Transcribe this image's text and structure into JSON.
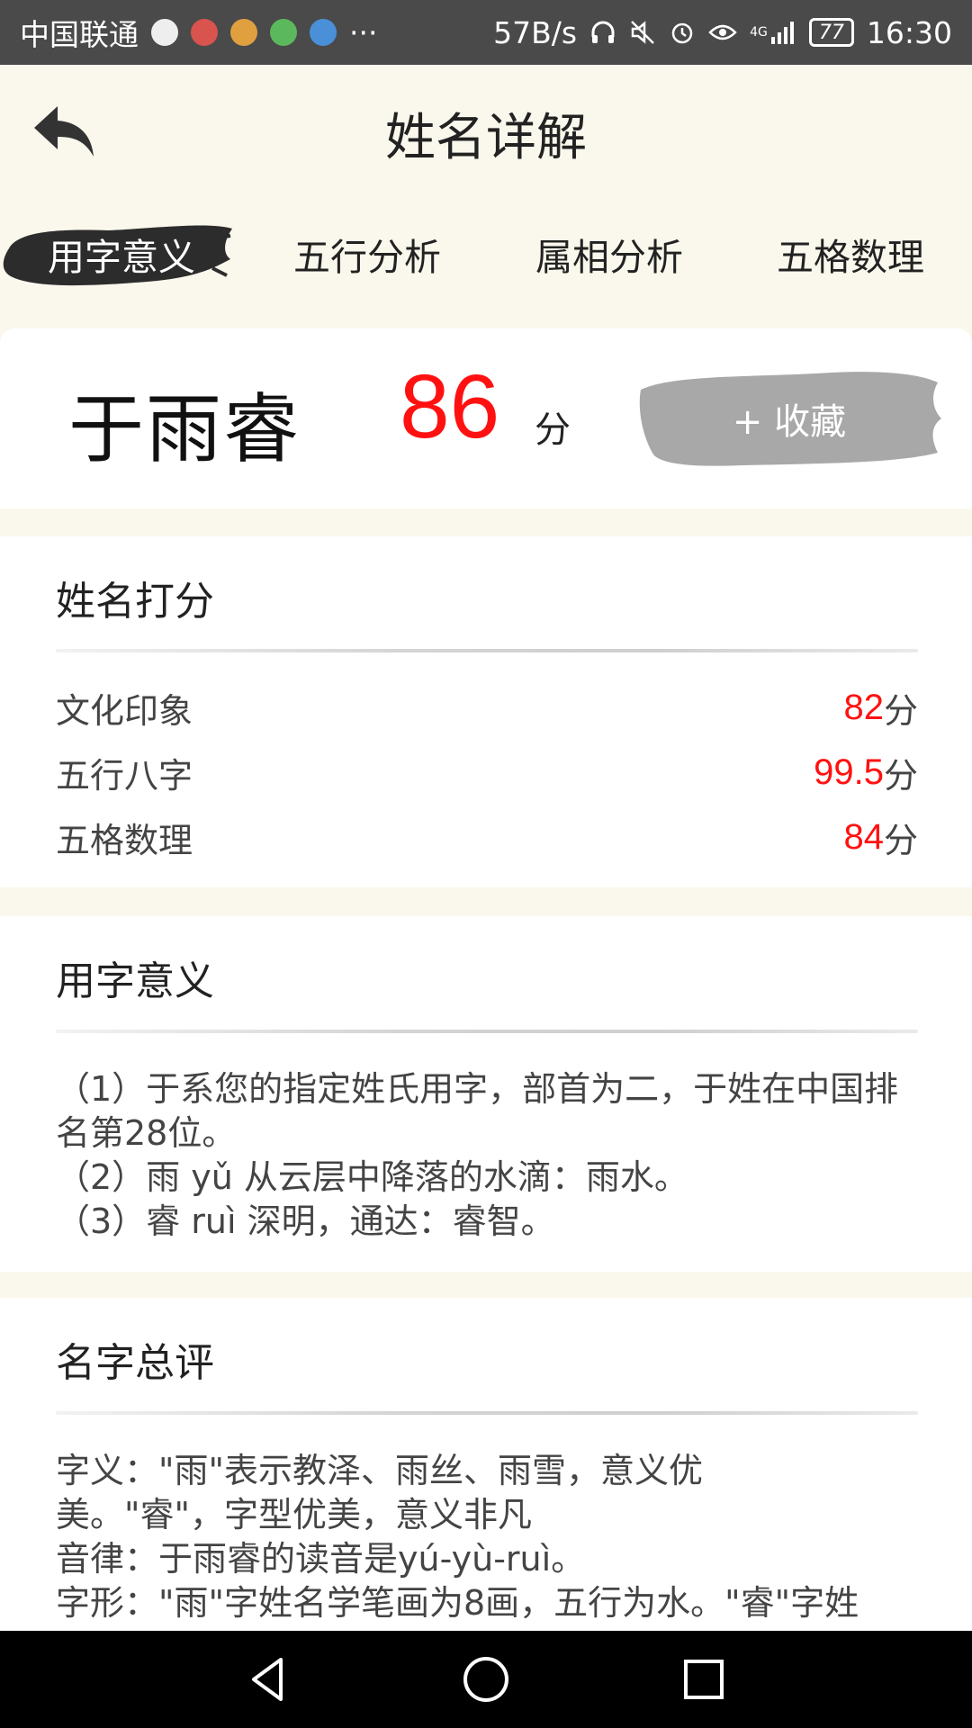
{
  "status_bar": {
    "carrier": "中国联通",
    "more": "···",
    "speed": "57B/s",
    "network": "4G",
    "battery": "77",
    "time": "16:30"
  },
  "header": {
    "title": "姓名详解"
  },
  "tabs": [
    {
      "label": "用字意义",
      "active": true
    },
    {
      "label": "五行分析",
      "active": false
    },
    {
      "label": "属相分析",
      "active": false
    },
    {
      "label": "五格数理",
      "active": false
    }
  ],
  "score": {
    "name": "于雨睿",
    "value": "86",
    "unit": "分",
    "favorite_label": "+ 收藏"
  },
  "rating": {
    "title": "姓名打分",
    "rows": [
      {
        "label": "文化印象",
        "value": "82",
        "unit": "分"
      },
      {
        "label": "五行八字",
        "value": "99.5",
        "unit": "分"
      },
      {
        "label": "五格数理",
        "value": "84",
        "unit": "分"
      }
    ]
  },
  "meaning": {
    "title": "用字意义",
    "lines": [
      "（1）于系您的指定姓氏用字，部首为二，于姓在中国排名第28位。",
      "（2）雨 yǔ 从云层中降落的水滴：雨水。",
      "（3）睿 ruì 深明，通达：睿智。"
    ]
  },
  "summary": {
    "title": "名字总评",
    "lines": [
      "字义：\"雨\"表示教泽、雨丝、雨雪，意义优美。\"睿\"，字型优美，意义非凡",
      "音律：于雨睿的读音是yú-yù-ruì。",
      "字形：\"雨\"字姓名学笔画为8画，五行为水。\"睿\"字姓"
    ]
  },
  "colors": {
    "accent_red": "#ff1111",
    "page_bg": "#faf8ec",
    "brush_dark": "#2c2c2c",
    "brush_gray": "#a8a8a8"
  }
}
